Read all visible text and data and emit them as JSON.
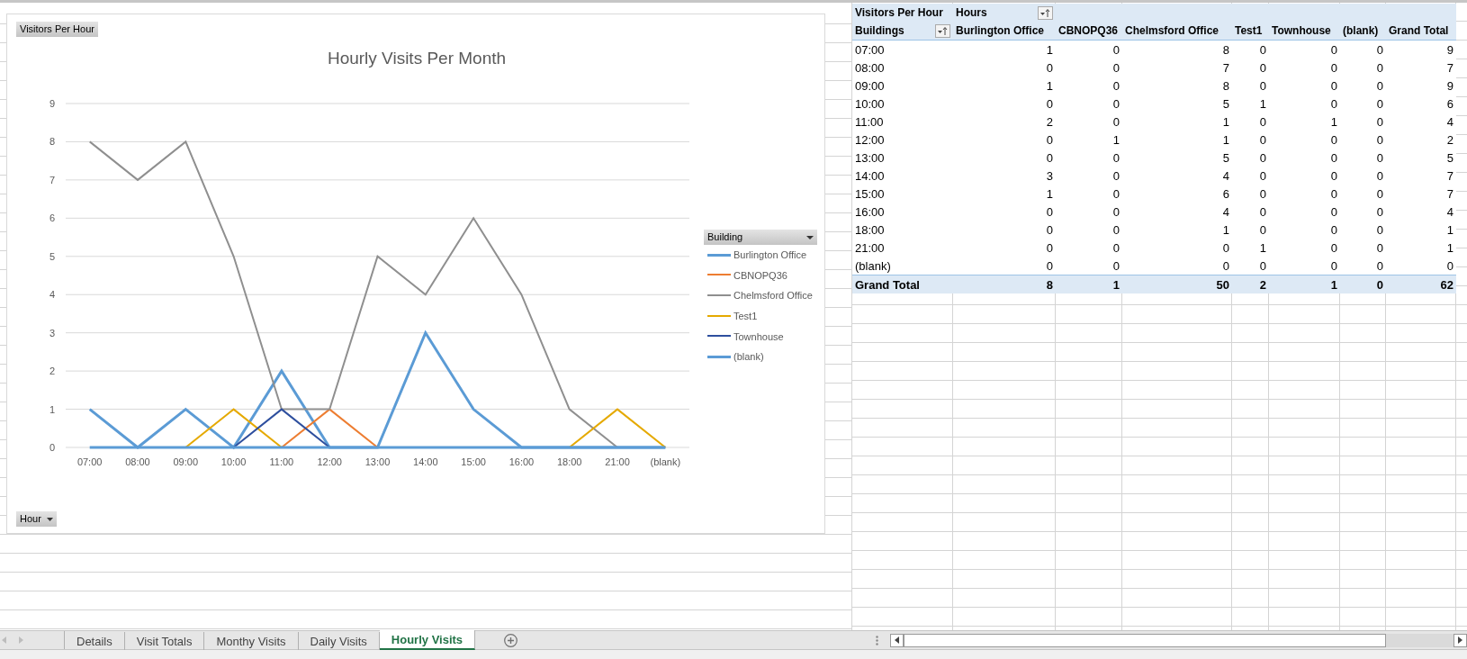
{
  "chart": {
    "field_button": "Visitors Per Hour",
    "axis_field_button": "Hour",
    "legend_field_button": "Building",
    "chart_data": {
      "type": "line",
      "title": "Hourly Visits Per Month",
      "categories": [
        "07:00",
        "08:00",
        "09:00",
        "10:00",
        "11:00",
        "12:00",
        "13:00",
        "14:00",
        "15:00",
        "16:00",
        "18:00",
        "21:00",
        "(blank)"
      ],
      "ylim": [
        0,
        9
      ],
      "yticks": [
        0,
        1,
        2,
        3,
        4,
        5,
        6,
        7,
        8,
        9
      ],
      "grid": true,
      "legend": true,
      "series": [
        {
          "name": "Burlington Office",
          "color": "#5b9bd5",
          "values": [
            1,
            0,
            1,
            0,
            2,
            0,
            0,
            3,
            1,
            0,
            0,
            0,
            0
          ]
        },
        {
          "name": "CBNOPQ36",
          "color": "#ed7d31",
          "values": [
            null,
            null,
            null,
            null,
            0,
            1,
            0,
            null,
            null,
            null,
            null,
            null,
            null
          ]
        },
        {
          "name": "Chelmsford Office",
          "color": "#8f8f8f",
          "values": [
            8,
            7,
            8,
            5,
            1,
            1,
            5,
            4,
            6,
            4,
            1,
            0,
            null
          ]
        },
        {
          "name": "Test1",
          "color": "#e5a900",
          "values": [
            null,
            null,
            0,
            1,
            0,
            null,
            null,
            null,
            null,
            null,
            0,
            1,
            0
          ]
        },
        {
          "name": "Townhouse",
          "color": "#2e4f9e",
          "values": [
            null,
            null,
            null,
            0,
            1,
            0,
            null,
            null,
            null,
            null,
            null,
            null,
            null
          ]
        },
        {
          "name": "(blank)",
          "color": "#5b9bd6",
          "values": [
            0,
            0,
            0,
            0,
            0,
            0,
            0,
            0,
            0,
            0,
            0,
            0,
            0
          ]
        }
      ]
    }
  },
  "pivot": {
    "corner_label": "Visitors Per Hour",
    "column_field": "Hours",
    "row_field": "Buildings",
    "columns": [
      "Burlington Office",
      "CBNOPQ36",
      "Chelmsford Office",
      "Test1",
      "Townhouse",
      "(blank)",
      "Grand Total"
    ],
    "rows": [
      {
        "label": "07:00",
        "values": [
          "1",
          "0",
          "8",
          "0",
          "0",
          "0",
          "9"
        ]
      },
      {
        "label": "08:00",
        "values": [
          "0",
          "0",
          "7",
          "0",
          "0",
          "0",
          "7"
        ]
      },
      {
        "label": "09:00",
        "values": [
          "1",
          "0",
          "8",
          "0",
          "0",
          "0",
          "9"
        ]
      },
      {
        "label": "10:00",
        "values": [
          "0",
          "0",
          "5",
          "1",
          "0",
          "0",
          "6"
        ]
      },
      {
        "label": "11:00",
        "values": [
          "2",
          "0",
          "1",
          "0",
          "1",
          "0",
          "4"
        ]
      },
      {
        "label": "12:00",
        "values": [
          "0",
          "1",
          "1",
          "0",
          "0",
          "0",
          "2"
        ]
      },
      {
        "label": "13:00",
        "values": [
          "0",
          "0",
          "5",
          "0",
          "0",
          "0",
          "5"
        ]
      },
      {
        "label": "14:00",
        "values": [
          "3",
          "0",
          "4",
          "0",
          "0",
          "0",
          "7"
        ]
      },
      {
        "label": "15:00",
        "values": [
          "1",
          "0",
          "6",
          "0",
          "0",
          "0",
          "7"
        ]
      },
      {
        "label": "16:00",
        "values": [
          "0",
          "0",
          "4",
          "0",
          "0",
          "0",
          "4"
        ]
      },
      {
        "label": "18:00",
        "values": [
          "0",
          "0",
          "1",
          "0",
          "0",
          "0",
          "1"
        ]
      },
      {
        "label": "21:00",
        "values": [
          "0",
          "0",
          "0",
          "1",
          "0",
          "0",
          "1"
        ]
      },
      {
        "label": "(blank)",
        "values": [
          "0",
          "0",
          "0",
          "0",
          "0",
          "0",
          "0"
        ]
      }
    ],
    "total_row": {
      "label": "Grand Total",
      "values": [
        "8",
        "1",
        "50",
        "2",
        "1",
        "0",
        "62"
      ]
    }
  },
  "sheet_tabs": [
    {
      "label": "Details",
      "selected": false
    },
    {
      "label": "Visit Totals",
      "selected": false
    },
    {
      "label": "Monthy Visits",
      "selected": false
    },
    {
      "label": "Daily Visits",
      "selected": false
    },
    {
      "label": "Hourly Visits",
      "selected": true
    }
  ]
}
